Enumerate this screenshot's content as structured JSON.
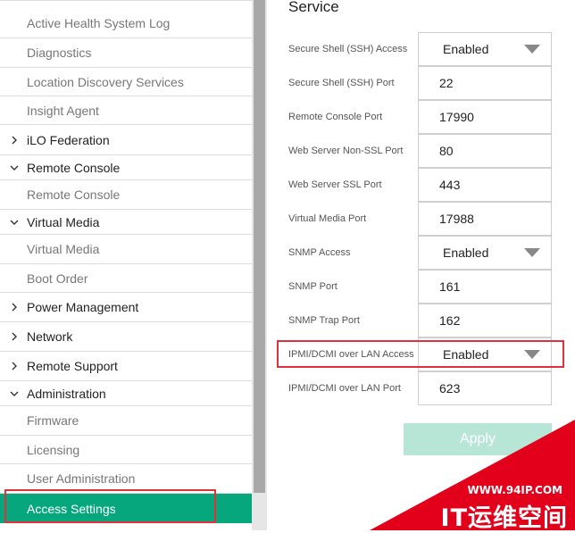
{
  "sidebar": {
    "items": [
      {
        "label": "Active Health System Log",
        "kind": "sub"
      },
      {
        "label": "Diagnostics",
        "kind": "sub"
      },
      {
        "label": "Location Discovery Services",
        "kind": "sub"
      },
      {
        "label": "Insight Agent",
        "kind": "sub"
      },
      {
        "label": "iLO Federation",
        "kind": "group",
        "expanded": false
      },
      {
        "label": "Remote Console",
        "kind": "group",
        "expanded": true
      },
      {
        "label": "Remote Console",
        "kind": "sub"
      },
      {
        "label": "Virtual Media",
        "kind": "group",
        "expanded": true
      },
      {
        "label": "Virtual Media",
        "kind": "sub"
      },
      {
        "label": "Boot Order",
        "kind": "sub"
      },
      {
        "label": "Power Management",
        "kind": "group",
        "expanded": false
      },
      {
        "label": "Network",
        "kind": "group",
        "expanded": false
      },
      {
        "label": "Remote Support",
        "kind": "group",
        "expanded": false
      },
      {
        "label": "Administration",
        "kind": "group",
        "expanded": true
      },
      {
        "label": "Firmware",
        "kind": "sub"
      },
      {
        "label": "Licensing",
        "kind": "sub"
      },
      {
        "label": "User Administration",
        "kind": "sub"
      },
      {
        "label": "Access Settings",
        "kind": "sub",
        "active": true
      }
    ]
  },
  "service": {
    "title": "Service",
    "rows": [
      {
        "label": "Secure Shell (SSH) Access",
        "value": "Enabled",
        "type": "select"
      },
      {
        "label": "Secure Shell (SSH) Port",
        "value": "22",
        "type": "input"
      },
      {
        "label": "Remote Console Port",
        "value": "17990",
        "type": "input"
      },
      {
        "label": "Web Server Non-SSL Port",
        "value": "80",
        "type": "input"
      },
      {
        "label": "Web Server SSL Port",
        "value": "443",
        "type": "input"
      },
      {
        "label": "Virtual Media Port",
        "value": "17988",
        "type": "input"
      },
      {
        "label": "SNMP Access",
        "value": "Enabled",
        "type": "select"
      },
      {
        "label": "SNMP Port",
        "value": "161",
        "type": "input"
      },
      {
        "label": "SNMP Trap Port",
        "value": "162",
        "type": "input"
      },
      {
        "label": "IPMI/DCMI over LAN Access",
        "value": "Enabled",
        "type": "select"
      },
      {
        "label": "IPMI/DCMI over LAN Port",
        "value": "623",
        "type": "input"
      }
    ],
    "apply_label": "Apply"
  },
  "watermark": {
    "url": "WWW.94IP.COM",
    "brand": "IT运维空间"
  },
  "colors": {
    "active": "#06a77d",
    "apply": "#b7e6d6",
    "highlight": "#e0323c",
    "watermark": "#e3001b"
  },
  "icons": {
    "collapsed": "chevron-right-icon",
    "expanded": "chevron-down-icon",
    "select": "caret-down-icon"
  }
}
